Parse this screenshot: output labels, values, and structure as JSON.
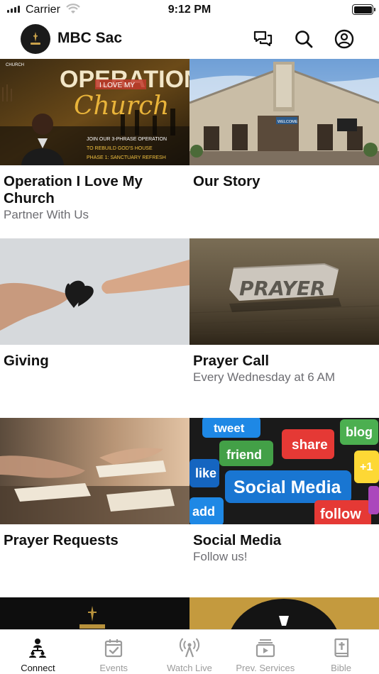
{
  "status_bar": {
    "carrier": "Carrier",
    "time": "9:12 PM"
  },
  "header": {
    "title": "MBC Sac",
    "icons": [
      "chat-icon",
      "search-icon",
      "account-icon"
    ]
  },
  "cards": [
    {
      "title": "Operation I Love My Church",
      "subtitle": "Partner With Us",
      "image": {
        "label": "CHURCH",
        "headline": "OPERATION",
        "banner": "I LOVE MY",
        "script": "Church",
        "line1": "JOIN OUR 3-PHRASE OPERATION",
        "line2": "TO REBUILD GOD'S HOUSE",
        "line3": "PHASE 1: SANCTUARY REFRESH"
      }
    },
    {
      "title": "Our Story",
      "subtitle": "",
      "image": {
        "sign": "WELCOME"
      }
    },
    {
      "title": "Giving",
      "subtitle": "",
      "image": {}
    },
    {
      "title": "Prayer Call",
      "subtitle": "Every Wednesday at 6 AM",
      "image": {
        "word": "PRAYER"
      }
    },
    {
      "title": "Prayer Requests",
      "subtitle": "",
      "image": {}
    },
    {
      "title": "Social Media",
      "subtitle": "Follow us!",
      "image": {
        "keys": [
          "tweet",
          "blog",
          "friend",
          "share",
          "like",
          "+1",
          "Social Media",
          "add",
          "follow"
        ]
      }
    }
  ],
  "tabs": [
    {
      "label": "Connect",
      "icon": "connect-icon",
      "active": true
    },
    {
      "label": "Events",
      "icon": "calendar-check-icon",
      "active": false
    },
    {
      "label": "Watch Live",
      "icon": "broadcast-icon",
      "active": false
    },
    {
      "label": "Prev. Services",
      "icon": "video-library-icon",
      "active": false
    },
    {
      "label": "Bible",
      "icon": "bible-icon",
      "active": false
    }
  ],
  "colors": {
    "tab_active": "#111111",
    "tab_inactive": "#9b9b9b",
    "subtitle": "#6d6d72"
  }
}
